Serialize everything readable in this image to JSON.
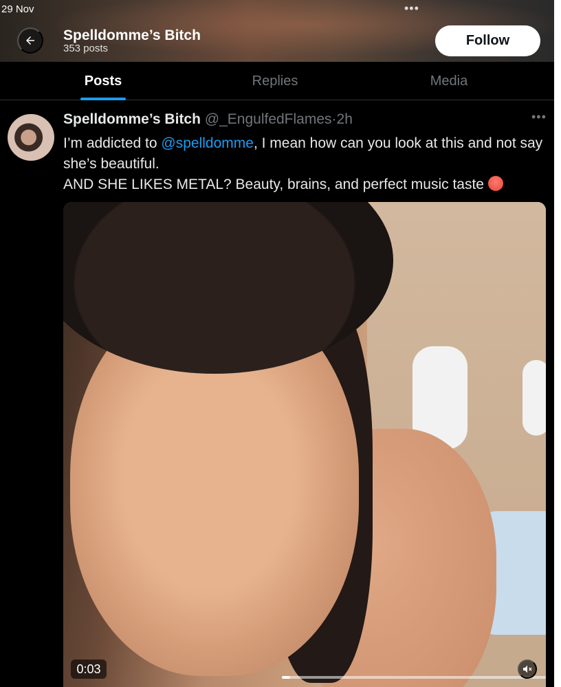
{
  "status_bar": {
    "date": "29 Nov",
    "more_dots": "•••"
  },
  "header": {
    "title": "Spelldomme’s Bitch",
    "subtitle": "353 posts",
    "follow_label": "Follow"
  },
  "tabs": [
    {
      "label": "Posts",
      "active": true
    },
    {
      "label": "Replies",
      "active": false
    },
    {
      "label": "Media",
      "active": false
    }
  ],
  "post": {
    "display_name": "Spelldomme’s Bitch",
    "handle": "@_EngulfedFlames",
    "separator": "·",
    "time": "2h",
    "more": "•••",
    "text_line1_prefix": "I’m addicted to ",
    "mention": "@spelldomme",
    "text_line1_suffix": ", I mean how can you look at this and not say she’s beautiful.",
    "text_line2": "AND SHE LIKES METAL? Beauty, brains, and perfect music taste ",
    "emoji_icon": "hot-face-emoji",
    "video": {
      "timecode": "0:03",
      "progress_fraction": 0.03,
      "muted": true
    }
  },
  "colors": {
    "accent": "#1d9bf0",
    "background": "#000000",
    "text": "#e7e9ea",
    "muted_text": "#71767b"
  }
}
